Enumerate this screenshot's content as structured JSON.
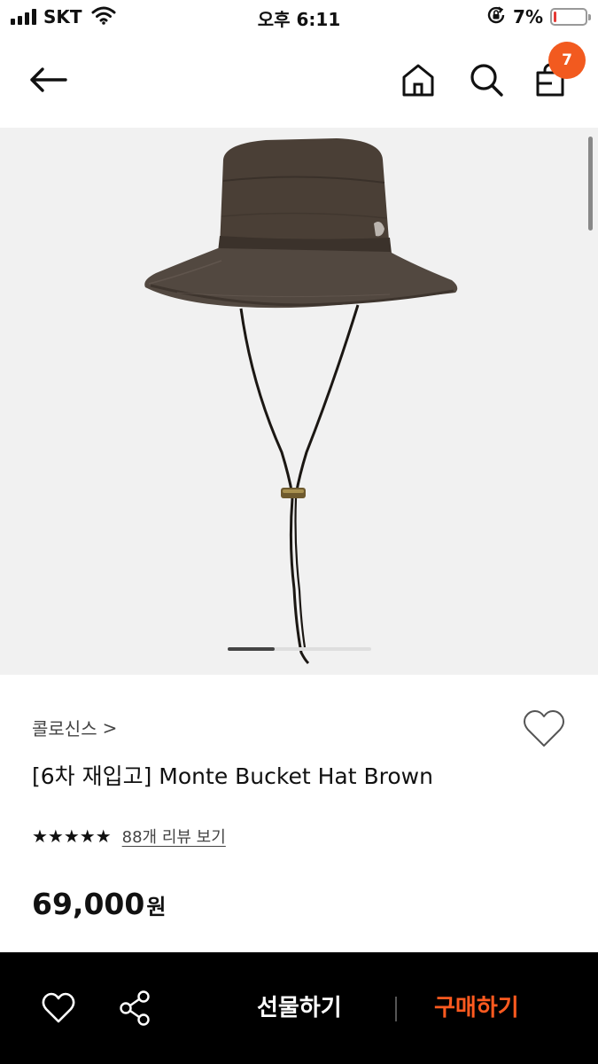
{
  "status_bar": {
    "carrier": "SKT",
    "time": "오후 6:11",
    "battery_percent": "7%",
    "battery_level": 0.07,
    "battery_color": "#e53935",
    "icons": [
      "signal-icon",
      "wifi-icon",
      "rotation-lock-icon",
      "battery-icon"
    ]
  },
  "nav": {
    "icons": [
      "back-arrow-icon",
      "home-icon",
      "search-icon",
      "cart-icon"
    ],
    "cart_badge": "7",
    "badge_color": "#f25a1f"
  },
  "product": {
    "image_icon": "bucket-hat-photo",
    "carousel_position": 0.33,
    "brand": "콜로신스",
    "brand_chevron": ">",
    "title": "[6차 재입고] Monte Bucket Hat Brown",
    "rating_stars": 5,
    "stars_text": "★★★★★",
    "review_link": "88개 리뷰 보기",
    "price": "69,000",
    "price_unit": "원"
  },
  "bottom_bar": {
    "gift_label": "선물하기",
    "buy_label": "구매하기",
    "buy_color": "#ff5a1f",
    "icons": [
      "heart-icon",
      "share-icon"
    ]
  }
}
